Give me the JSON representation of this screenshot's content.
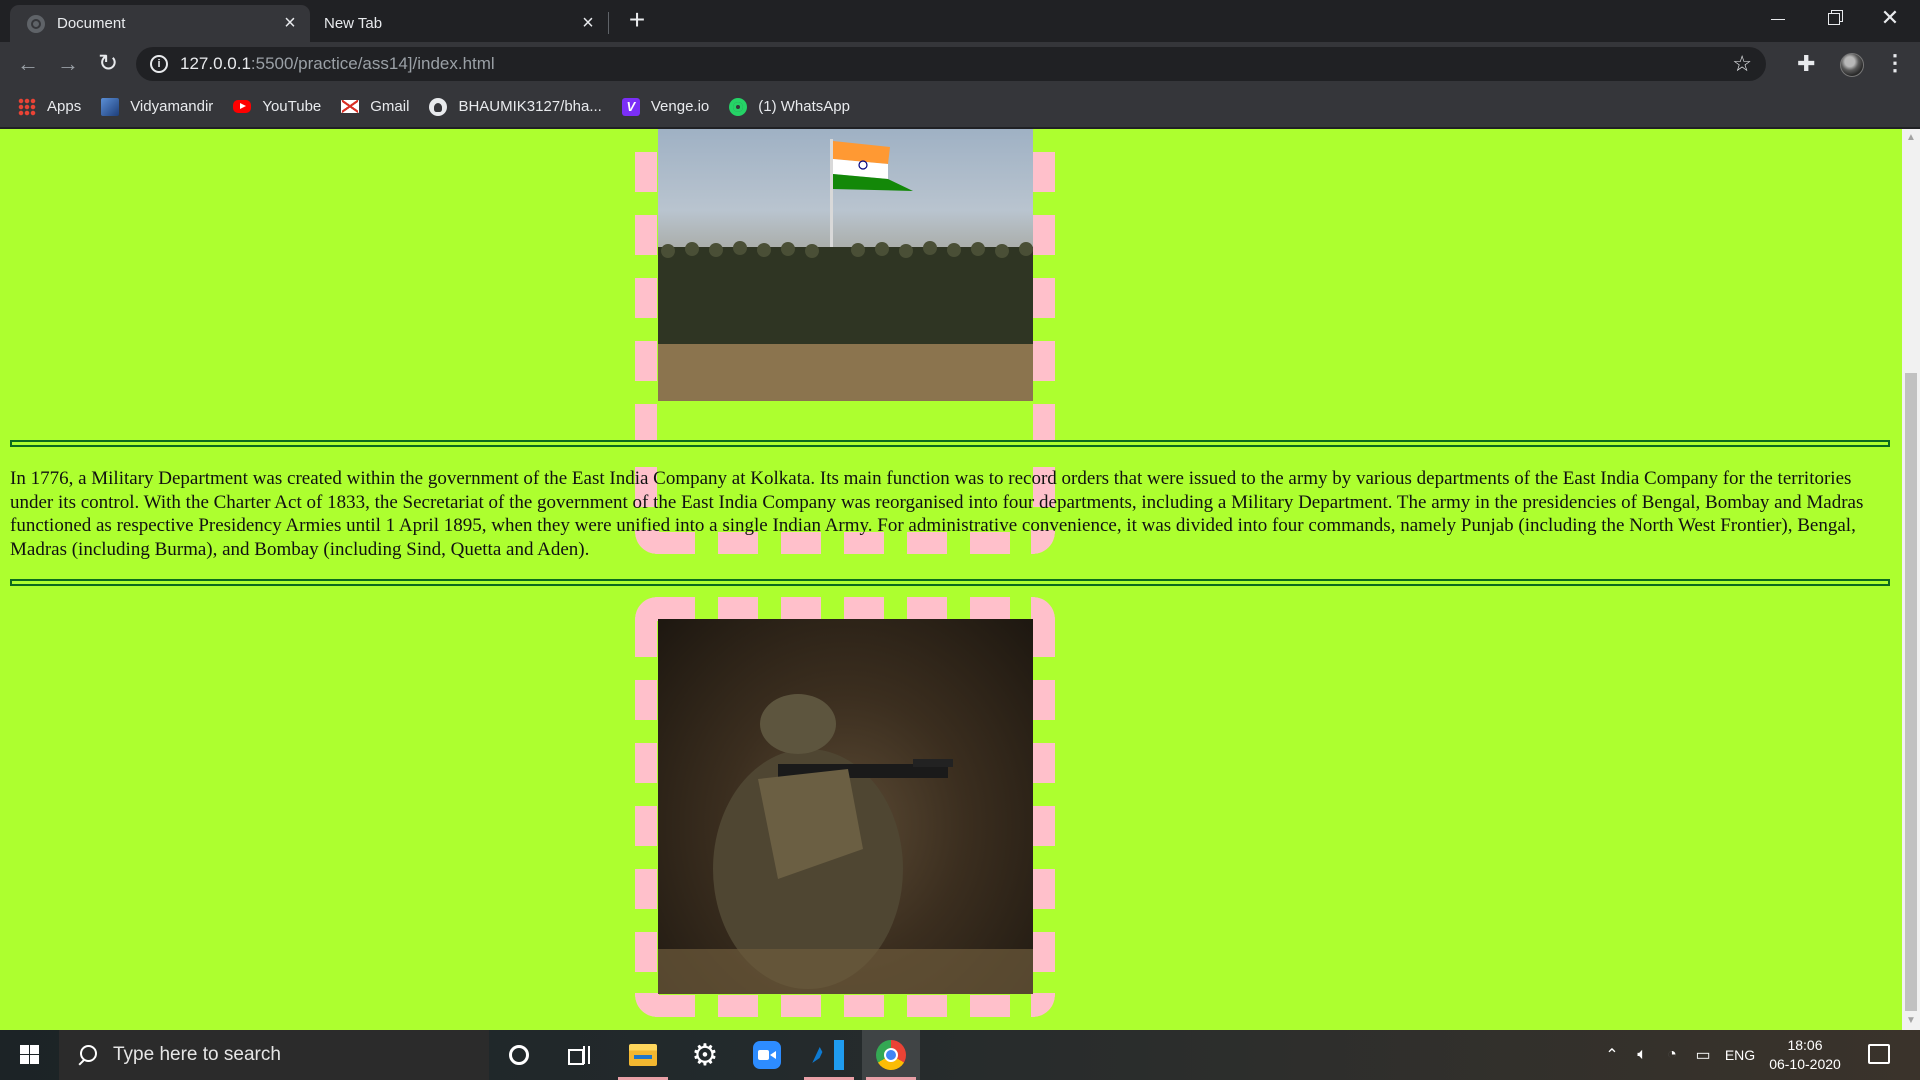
{
  "browser": {
    "tabs": [
      {
        "title": "Document",
        "active": true
      },
      {
        "title": "New Tab",
        "active": false
      }
    ],
    "url_host": "127.0.0.1",
    "url_path": ":5500/practice/ass14]/index.html",
    "bookmarks": [
      {
        "label": "Apps",
        "icon": "apps-icon"
      },
      {
        "label": "Vidyamandir",
        "icon": "vidyamandir-icon"
      },
      {
        "label": "YouTube",
        "icon": "youtube-icon"
      },
      {
        "label": "Gmail",
        "icon": "gmail-icon"
      },
      {
        "label": "BHAUMIK3127/bha...",
        "icon": "github-icon"
      },
      {
        "label": "Venge.io",
        "icon": "venge-icon"
      },
      {
        "label": "(1) WhatsApp",
        "icon": "whatsapp-icon"
      }
    ]
  },
  "page": {
    "background_color": "#adff2f",
    "frame_color": "#ffc0cb",
    "divider_color": "#0b6b1e",
    "paragraph": "In 1776, a Military Department was created within the government of the East India Company at Kolkata. Its main function was to record orders that were issued to the army by various departments of the East India Company for the territories under its control. With the Charter Act of 1833, the Secretariat of the government of the East India Company was reorganised into four departments, including a Military Department. The army in the presidencies of Bengal, Bombay and Madras functioned as respective Presidency Armies until 1 April 1895, when they were unified into a single Indian Army. For administrative convenience, it was divided into four commands, namely Punjab (including the North West Frontier), Bengal, Madras (including Burma), and Bombay (including Sind, Quetta and Aden).",
    "venge_letter": "V"
  },
  "taskbar": {
    "search_placeholder": "Type here to search",
    "language": "ENG",
    "time": "18:06",
    "date": "06-10-2020"
  }
}
